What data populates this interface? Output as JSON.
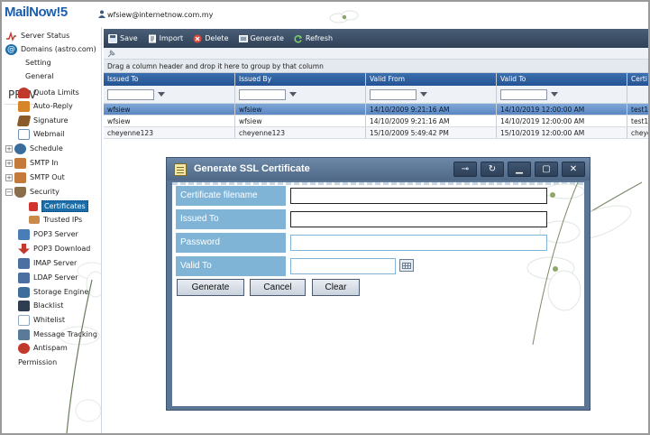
{
  "app": {
    "logo": "MailNow!5",
    "user": "wfsiew@internetnow.com.my",
    "prev_label": "PREV"
  },
  "sidebar": {
    "items": [
      {
        "label": "Server Status",
        "icon": "pulse-icon",
        "color": "#c0392b"
      },
      {
        "label": "Domains (astro.com)",
        "icon": "at-icon",
        "color": "#1d6ea8"
      },
      {
        "label": "Setting",
        "icon": "settings-icon",
        "color": "#7a8a99"
      },
      {
        "label": "General",
        "icon": "general-icon",
        "color": "#7a8a99"
      },
      {
        "label": "Quota Limits",
        "icon": "quota-icon",
        "color": "#c0392b"
      },
      {
        "label": "Auto-Reply",
        "icon": "reply-icon",
        "color": "#d6852a"
      },
      {
        "label": "Signature",
        "icon": "signature-icon",
        "color": "#8b5a2b"
      },
      {
        "label": "Webmail",
        "icon": "webmail-icon",
        "color": "#6e8fb2"
      },
      {
        "label": "Schedule",
        "icon": "clock-icon",
        "color": "#3a6d9c"
      },
      {
        "label": "SMTP In",
        "icon": "smtp-in-icon",
        "color": "#c47a3a"
      },
      {
        "label": "SMTP Out",
        "icon": "smtp-out-icon",
        "color": "#c47a3a"
      },
      {
        "label": "Security",
        "icon": "shield-icon",
        "color": "#8a6d4a"
      },
      {
        "label": "Certificates",
        "icon": "certificate-icon",
        "color": "#d0342c",
        "selected": true
      },
      {
        "label": "Trusted IPs",
        "icon": "trusted-ip-icon",
        "color": "#c98a4a"
      },
      {
        "label": "POP3 Server",
        "icon": "pop3-server-icon",
        "color": "#4a7cb5"
      },
      {
        "label": "POP3 Download",
        "icon": "download-icon",
        "color": "#c0392b"
      },
      {
        "label": "IMAP Server",
        "icon": "imap-icon",
        "color": "#4a6fa0"
      },
      {
        "label": "LDAP Server",
        "icon": "ldap-icon",
        "color": "#4a6fa0"
      },
      {
        "label": "Storage Engine",
        "icon": "storage-icon",
        "color": "#3f6d9a"
      },
      {
        "label": "Blacklist",
        "icon": "blacklist-icon",
        "color": "#2e3d4f"
      },
      {
        "label": "Whitelist",
        "icon": "whitelist-icon",
        "color": "#8fa9c4"
      },
      {
        "label": "Message Tracking",
        "icon": "tracking-icon",
        "color": "#5a7a9a"
      },
      {
        "label": "Antispam",
        "icon": "antispam-icon",
        "color": "#c0392b"
      },
      {
        "label": "Permission",
        "icon": "permission-icon",
        "color": "#8a8a8a"
      }
    ]
  },
  "toolbar": {
    "save": "Save",
    "import": "Import",
    "delete": "Delete",
    "generate": "Generate",
    "refresh": "Refresh"
  },
  "grid": {
    "group_hint": "Drag a column header and drop it here to group by that column",
    "columns": [
      "Issued To",
      "Issued By",
      "Valid From",
      "Valid To",
      "Certi"
    ],
    "rows": [
      {
        "issued_to": "wfsiew",
        "issued_by": "wfsiew",
        "valid_from": "14/10/2009 9:21:16 AM",
        "valid_to": "14/10/2019 12:00:00 AM",
        "cert": "test1"
      },
      {
        "issued_to": "wfsiew",
        "issued_by": "wfsiew",
        "valid_from": "14/10/2009 9:21:16 AM",
        "valid_to": "14/10/2019 12:00:00 AM",
        "cert": "test1"
      },
      {
        "issued_to": "cheyenne123",
        "issued_by": "cheyenne123",
        "valid_from": "15/10/2009 5:49:42 PM",
        "valid_to": "15/10/2019 12:00:00 AM",
        "cert": "cheye"
      }
    ]
  },
  "dialog": {
    "title": "Generate SSL Certificate",
    "fields": {
      "filename_label": "Certificate filename",
      "issued_to_label": "Issued To",
      "password_label": "Password",
      "valid_to_label": "Valid To"
    },
    "buttons": {
      "generate": "Generate",
      "cancel": "Cancel",
      "clear": "Clear"
    }
  }
}
